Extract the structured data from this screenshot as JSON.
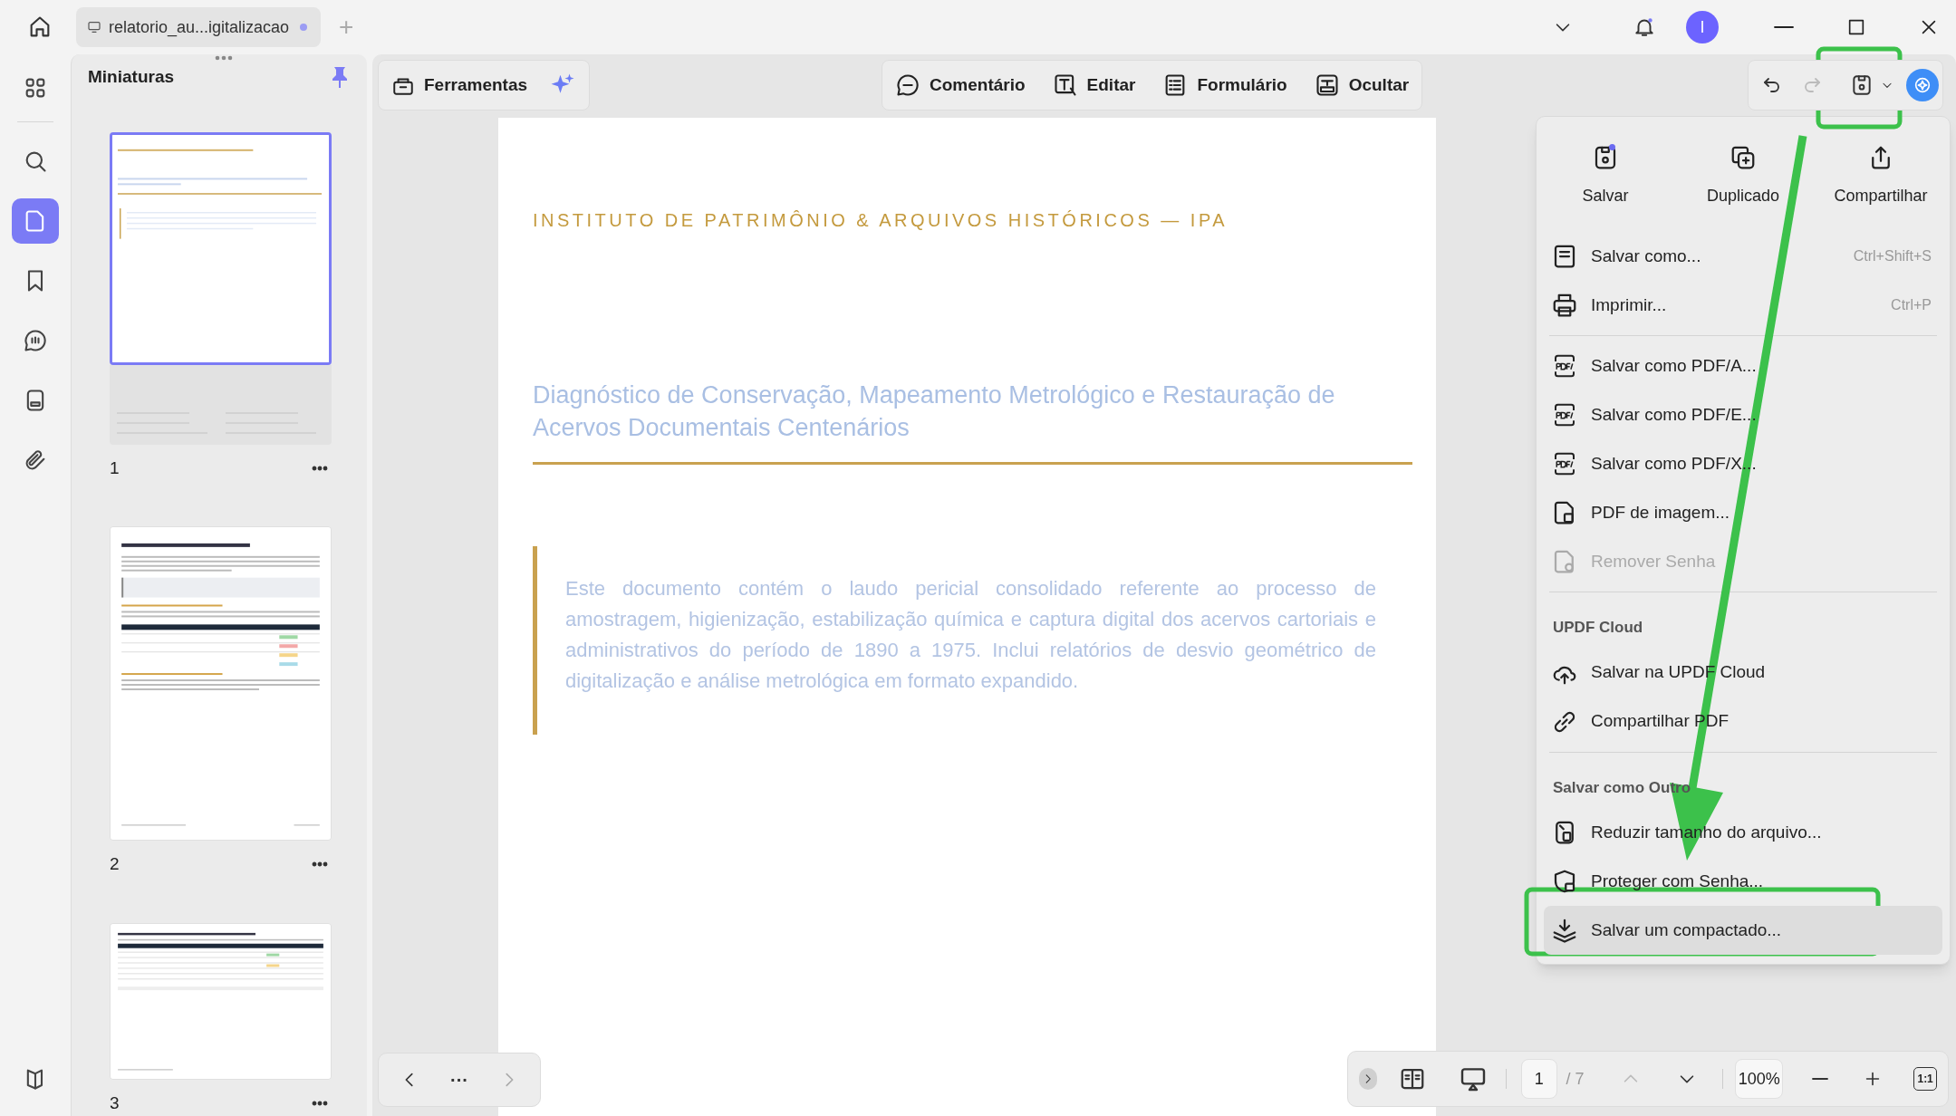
{
  "title_bar": {
    "tab": {
      "title": "relatorio_au...igitalizacao",
      "modified": true
    },
    "new_tab": "+",
    "avatar": "I"
  },
  "left_rail": {
    "items": [
      {
        "selected": false
      },
      {
        "selected": false
      },
      {
        "selected": true
      },
      {
        "selected": false
      },
      {
        "selected": false
      },
      {
        "selected": false
      },
      {
        "selected": false
      }
    ]
  },
  "thumbnail_panel": {
    "title": "Miniaturas",
    "pages": [
      {
        "number": "1",
        "selected": true
      },
      {
        "number": "2",
        "selected": false
      },
      {
        "number": "3",
        "selected": false
      }
    ]
  },
  "toolbar": {
    "tools_button": "Ferramentas",
    "modes": [
      "Comentário",
      "Editar",
      "Formulário",
      "Ocultar"
    ]
  },
  "document": {
    "institution": "INSTITUTO DE PATRIMÔNIO & ARQUIVOS HISTÓRICOS — IPA",
    "title": "Diagnóstico de Conservação, Mapeamento Metrológico e Restauração de Acervos Documentais Centenários",
    "abstract": "Este documento contém o laudo pericial consolidado referente ao processo de amostragem, higienização, estabilização química e captura digital dos acervos cartoriais e administrativos do período de 1890 a 1975. Inclui relatórios de desvio geométrico de digitalização e análise metrológica em formato expandido."
  },
  "save_menu": {
    "top_actions": [
      {
        "label": "Salvar",
        "badge": true
      },
      {
        "label": "Duplicado",
        "badge": false
      },
      {
        "label": "Compartilhar",
        "badge": false
      }
    ],
    "groups": [
      {
        "items": [
          {
            "label": "Salvar como...",
            "shortcut": "Ctrl+Shift+S",
            "disabled": false,
            "selected": false
          },
          {
            "label": "Imprimir...",
            "shortcut": "Ctrl+P",
            "disabled": false,
            "selected": false
          }
        ]
      },
      {
        "items": [
          {
            "label": "Salvar como PDF/A...",
            "disabled": false,
            "selected": false
          },
          {
            "label": "Salvar como PDF/E...",
            "disabled": false,
            "selected": false
          },
          {
            "label": "Salvar como PDF/X...",
            "disabled": false,
            "selected": false
          },
          {
            "label": "PDF de imagem...",
            "disabled": false,
            "selected": false
          },
          {
            "label": "Remover Senha",
            "disabled": true,
            "selected": false
          }
        ]
      },
      {
        "heading": "UPDF Cloud",
        "items": [
          {
            "label": "Salvar na UPDF Cloud",
            "disabled": false,
            "selected": false
          },
          {
            "label": "Compartilhar PDF",
            "disabled": false,
            "selected": false
          }
        ]
      },
      {
        "heading": "Salvar como Outro",
        "items": [
          {
            "label": "Reduzir tamanho do arquivo...",
            "disabled": false,
            "selected": false
          },
          {
            "label": "Proteger com Senha...",
            "disabled": false,
            "selected": false
          },
          {
            "label": "Salvar um compactado...",
            "disabled": false,
            "selected": true
          }
        ]
      }
    ]
  },
  "page_nav": {
    "more": "···",
    "current": "1",
    "total": "/ 7",
    "zoom": "100%",
    "actual_size": "1:1"
  }
}
